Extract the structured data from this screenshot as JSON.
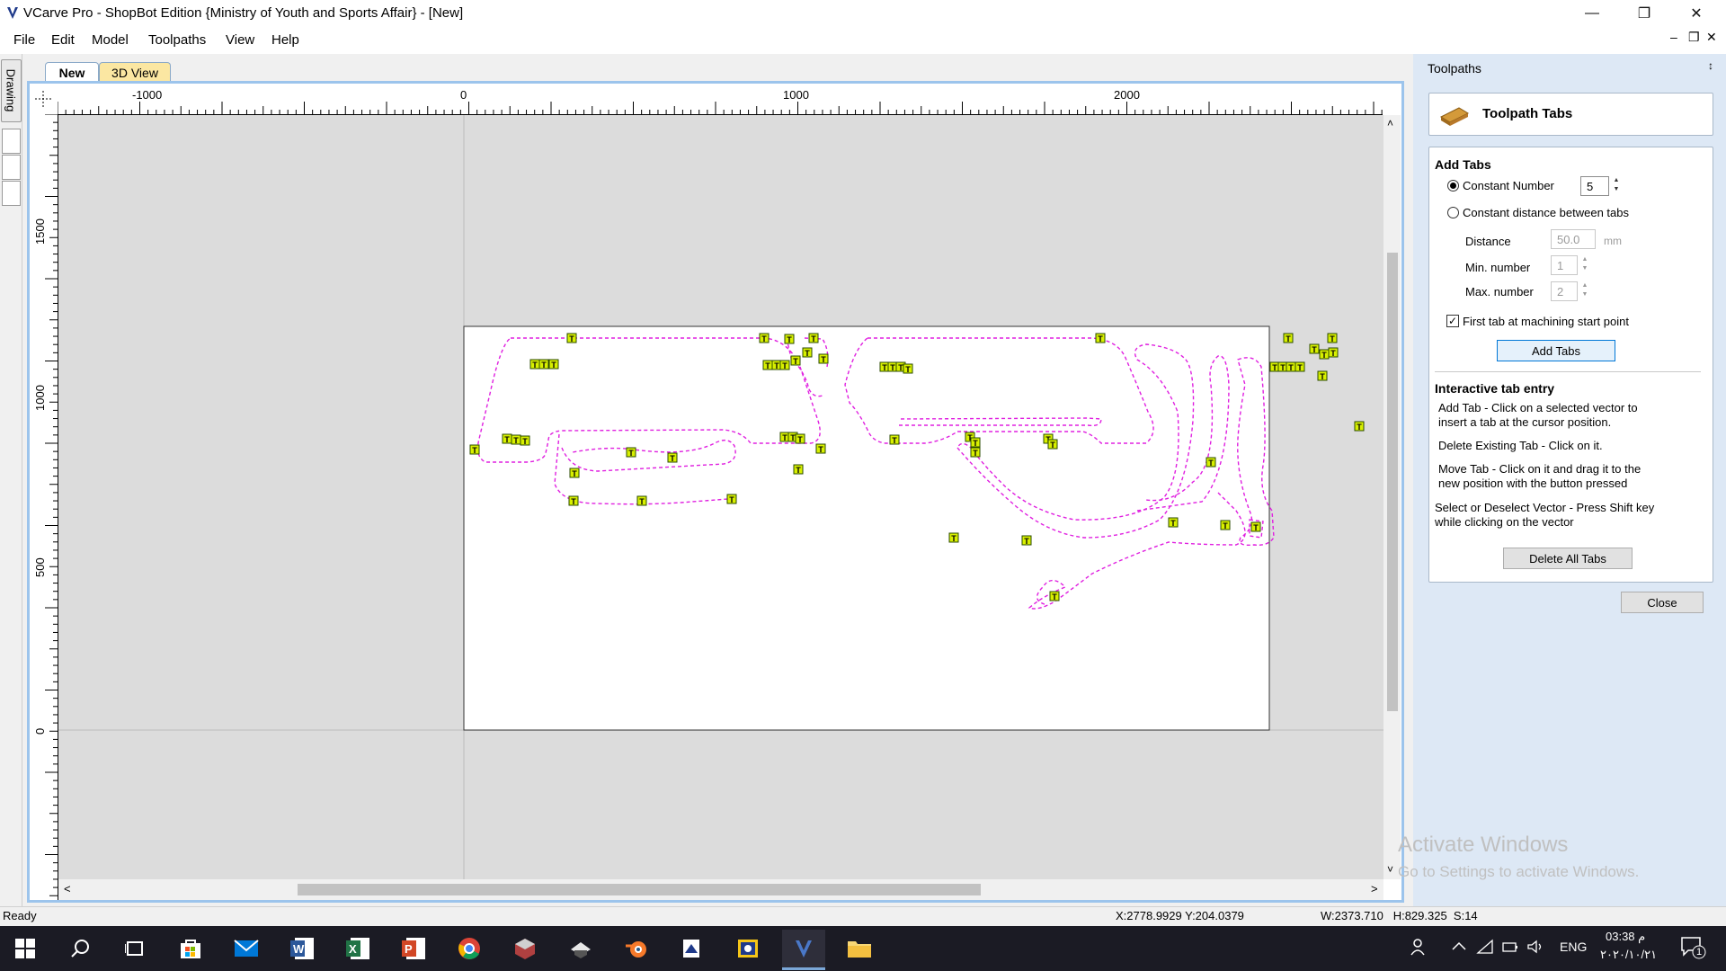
{
  "window": {
    "title": "VCarve Pro - ShopBot Edition {Ministry of Youth and Sports Affair} - [New]",
    "minimize_glyph": "—",
    "restore_glyph": "❐",
    "close_glyph": "✕"
  },
  "menu": {
    "items": [
      "File",
      "Edit",
      "Model",
      "Toolpaths",
      "View",
      "Help"
    ],
    "mdi_controls": [
      "–",
      "❐",
      "✕"
    ]
  },
  "left_strip": {
    "drawing_label": "Drawing"
  },
  "doc_tabs": {
    "new_label": "New",
    "view3d_label": "3D View"
  },
  "rulers": {
    "h_labels": [
      "-1000",
      "0",
      "1000",
      "2000"
    ],
    "v_labels": [
      "1500",
      "1000",
      "500",
      "0"
    ]
  },
  "tab_marker_glyph": "T",
  "scrollbar": {
    "up": "˄",
    "down": "˅",
    "left": "<",
    "right": ">"
  },
  "panel": {
    "title": "Toolpaths",
    "pin_glyph": "↕",
    "header_title": "Toolpath Tabs",
    "add_tabs_heading": "Add Tabs",
    "constant_number_label": "Constant Number",
    "constant_number_value": "5",
    "constant_distance_label": "Constant distance between tabs",
    "distance_label": "Distance",
    "distance_value": "50.0",
    "distance_unit": "mm",
    "min_number_label": "Min. number",
    "min_number_value": "1",
    "max_number_label": "Max. number",
    "max_number_value": "2",
    "first_tab_label": "First tab at machining start point",
    "first_tab_checked": true,
    "add_tabs_button": "Add Tabs",
    "interactive_heading": "Interactive tab entry",
    "help_add_1": "Add Tab - Click on a selected vector to",
    "help_add_2": "insert a tab at the cursor position.",
    "help_delete": "Delete Existing Tab - Click on it.",
    "help_move_1": "Move Tab - Click on it and drag it to the",
    "help_move_2": "new position with the button pressed",
    "help_select_1": "Select or Deselect Vector - Press Shift key",
    "help_select_2": "while clicking on the vector",
    "delete_all_button": "Delete All Tabs",
    "close_button": "Close"
  },
  "status": {
    "ready": "Ready",
    "coords": "X:2778.9929 Y:204.0379",
    "size": "W:2373.710   H:829.325  S:14"
  },
  "watermark": {
    "line1": "Activate Windows",
    "line2": "Go to Settings to activate Windows."
  },
  "taskbar": {
    "icons": [
      "start-icon",
      "search-icon",
      "task-view-icon",
      "store-icon",
      "mail-icon",
      "word-icon",
      "excel-icon",
      "powerpoint-icon",
      "chrome-icon",
      "app-cube-icon",
      "app-hat-icon",
      "blender-icon",
      "app-docs-icon",
      "app-image-icon",
      "vcarve-icon",
      "file-explorer-icon"
    ],
    "lang": "ENG",
    "time": "03:38 م",
    "date": "٢٠٢٠/١٠/٢١",
    "notification_count": "1"
  }
}
